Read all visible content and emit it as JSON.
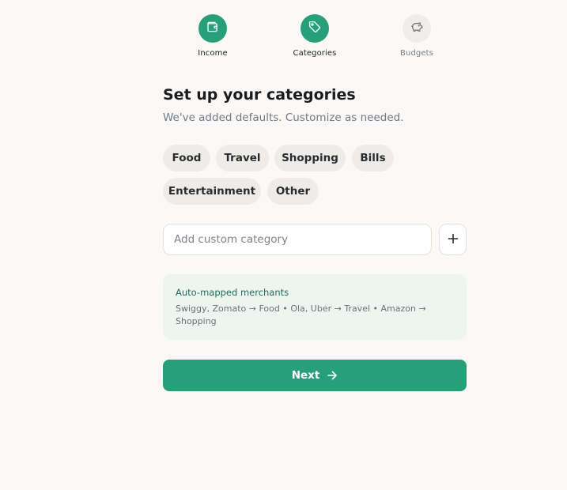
{
  "stepper": {
    "steps": [
      {
        "label": "Income",
        "state": "completed",
        "icon": "wallet-icon"
      },
      {
        "label": "Categories",
        "state": "active",
        "icon": "tag-icon"
      },
      {
        "label": "Budgets",
        "state": "inactive",
        "icon": "piggy-bank-icon"
      }
    ]
  },
  "main": {
    "title": "Set up your categories",
    "subtitle": "We've added defaults. Customize as needed.",
    "categories": [
      "Food",
      "Travel",
      "Shopping",
      "Bills",
      "Entertainment",
      "Other"
    ],
    "custom_input": {
      "placeholder": "Add custom category",
      "value": ""
    },
    "add_button_icon": "plus-icon",
    "info": {
      "title": "Auto-mapped merchants",
      "text": "Swiggy, Zomato → Food • Ola, Uber → Travel • Amazon → Shopping"
    },
    "next_button": {
      "label": "Next",
      "icon": "arrow-right-icon"
    }
  },
  "colors": {
    "accent": "#27A07A",
    "background": "#FAF9F7",
    "chip_bg": "#EDECEA",
    "info_bg": "#EEF5F1",
    "info_title": "#1F6E55"
  }
}
